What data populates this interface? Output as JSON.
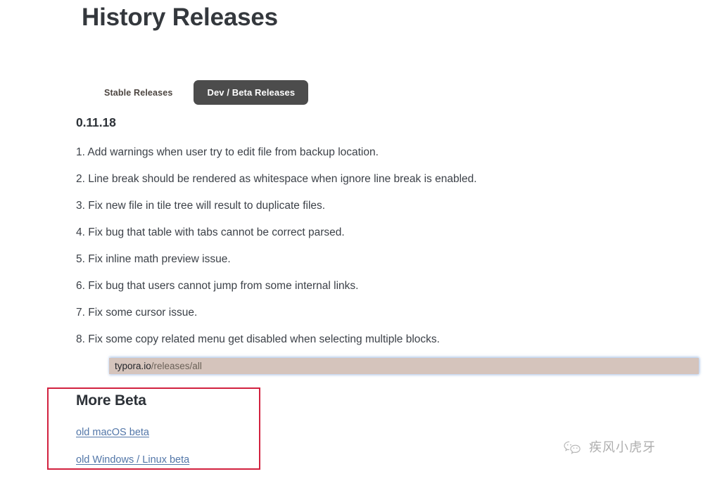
{
  "page": {
    "title": "History Releases",
    "background_color": "#ffffff"
  },
  "tabs": [
    {
      "label": "Stable Releases",
      "active": false
    },
    {
      "label": "Dev / Beta Releases",
      "active": true
    }
  ],
  "release": {
    "version": "0.11.18",
    "items": [
      "1. Add warnings when user try to edit file from backup location.",
      "2. Line break should be rendered as whitespace when ignore line break is enabled.",
      "3. Fix new file in tile tree will result to duplicate files.",
      "4. Fix bug that table with tabs cannot be correct parsed.",
      "5. Fix inline math preview issue.",
      "6. Fix bug that users cannot jump from some internal links.",
      "7. Fix some cursor issue.",
      "8. Fix some copy related menu get disabled when selecting multiple blocks."
    ]
  },
  "url_bar": {
    "host": "typora.io",
    "path": "/releases/all",
    "full": "typora.io/releases/all",
    "background_color": "#d5c4bc"
  },
  "more_beta": {
    "heading": "More Beta",
    "highlight_color": "#d2213f",
    "links": [
      {
        "label": "old macOS beta"
      },
      {
        "label": "old Windows / Linux beta"
      }
    ]
  },
  "watermark": {
    "text": "疾风小虎牙",
    "icon": "wechat-bubbles-icon"
  },
  "colors": {
    "active_tab_background": "#4c4c4c",
    "active_tab_text": "#ffffff",
    "link": "#5276a8",
    "body_text": "#3c4148"
  }
}
